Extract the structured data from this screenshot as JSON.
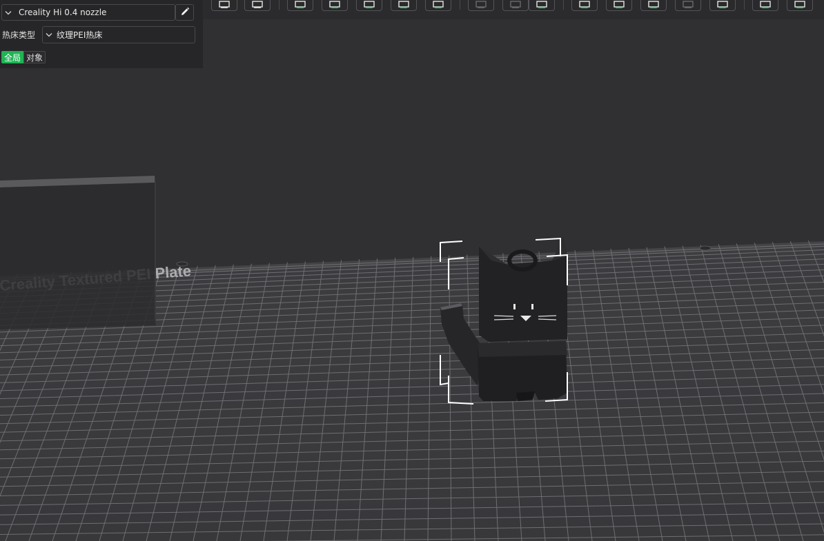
{
  "panel": {
    "printer_name": "Creality Hi 0.4 nozzle",
    "printer_select_icon": "chevron-down-icon",
    "edit_icon": "pencil-icon",
    "bed_type_label": "热床类型",
    "bed_type_value": "纹理PEI热床",
    "tabs": [
      {
        "label": "全局",
        "active": true
      },
      {
        "label": "对象",
        "active": false
      }
    ]
  },
  "toolbar": {
    "buttons": [
      {
        "icon": "cube-view-icon",
        "enabled": true
      },
      {
        "icon": "grid-arrange-icon",
        "enabled": true
      },
      {
        "icon": "add-model-icon",
        "enabled": true
      },
      {
        "icon": "orient-icon",
        "enabled": true
      },
      {
        "icon": "lay-flat-icon",
        "enabled": true
      },
      {
        "icon": "arrange-icon",
        "enabled": true
      },
      {
        "icon": "drop-to-bed-icon",
        "enabled": true
      },
      {
        "icon": "split-objects-icon",
        "enabled": false
      },
      {
        "icon": "split-parts-icon",
        "enabled": false
      },
      {
        "icon": "scale-icon",
        "enabled": true
      },
      {
        "icon": "cut-icon",
        "enabled": true
      },
      {
        "icon": "hollow-icon",
        "enabled": true
      },
      {
        "icon": "measure-icon",
        "enabled": true
      },
      {
        "icon": "boolean-icon",
        "enabled": false
      },
      {
        "icon": "support-paint-icon",
        "enabled": true
      },
      {
        "icon": "seam-paint-icon",
        "enabled": true
      },
      {
        "icon": "text-emboss-icon",
        "enabled": true
      }
    ]
  },
  "scene": {
    "plate_label": "Creality Textured PEI Plate",
    "model_name": "cat-model",
    "colors": {
      "background": "#2f2f31",
      "plate": "#3a3a3c",
      "grid": "#7a7a7e",
      "model": "#222224",
      "accent": "#1fb455"
    }
  }
}
